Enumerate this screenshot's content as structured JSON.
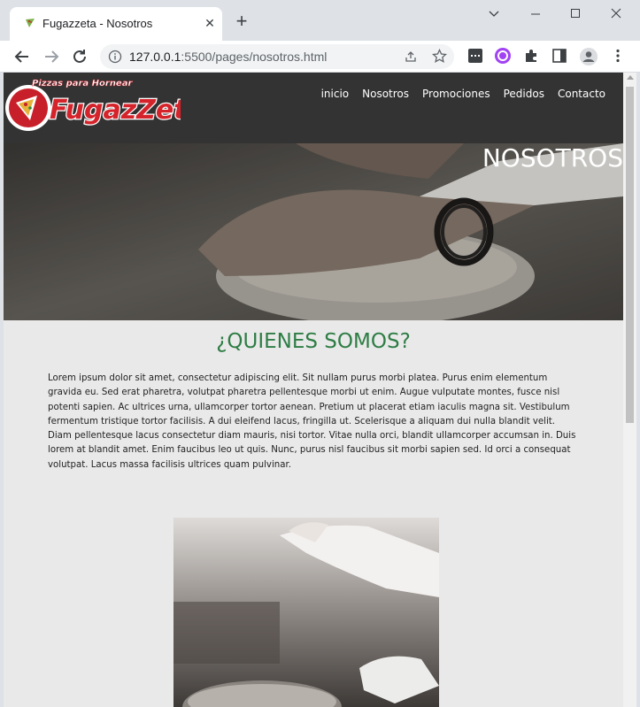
{
  "browser": {
    "tab_title": "Fugazzeta - Nosotros",
    "url_host": "127.0.0.1",
    "url_rest": ":5500/pages/nosotros.html",
    "accent": "#1a73e8"
  },
  "site": {
    "logo_tagline": "Pizzas para Hornear",
    "logo_text": "FugazZeta",
    "menu": [
      "inicio",
      "Nosotros",
      "Promociones",
      "Pedidos",
      "Contacto"
    ],
    "hero_title": "NOSOTROS",
    "section_title": "¿QUIENES SOMOS?",
    "paragraph": "Lorem ipsum dolor sit amet, consectetur adipiscing elit. Sit nullam purus morbi platea. Purus enim elementum gravida eu. Sed erat pharetra, volutpat pharetra pellentesque morbi ut enim. Augue vulputate montes, fusce nisl potenti sapien. Ac ultrices urna, ullamcorper tortor aenean. Pretium ut placerat etiam iaculis magna sit. Vestibulum fermentum tristique tortor facilisis. A dui eleifend lacus, fringilla ut. Scelerisque a aliquam dui nulla blandit velit. Diam pellentesque lacus consectetur diam mauris, nisi tortor. Vitae nulla orci, blandit ullamcorper accumsan in. Duis lorem at blandit amet. Enim faucibus leo ut quis. Nunc, purus nisl faucibus sit morbi sapien sed. Id orci a consequat volutpat. Lacus massa facilisis ultrices quam pulvinar.",
    "title_color": "#2e7d45",
    "header_color": "#333333"
  },
  "icons": [
    "back-icon",
    "forward-icon",
    "reload-icon",
    "site-info-icon",
    "share-icon",
    "bookmark-star-icon",
    "extension-icon",
    "puzzle-icon",
    "side-panel-icon",
    "profile-icon",
    "menu-dots-icon"
  ]
}
